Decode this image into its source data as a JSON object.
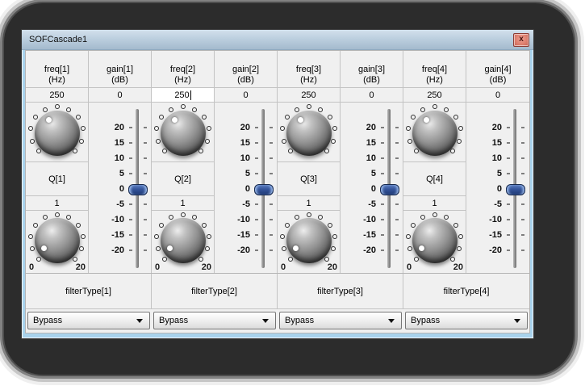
{
  "window": {
    "title": "SOFCascade1",
    "close_glyph": "x"
  },
  "knobs": {
    "freq_indicator_angle_deg": -32,
    "q_indicator_angle_deg": -121
  },
  "gain_scale": {
    "ticks": [
      "20",
      "15",
      "10",
      "5",
      "0",
      "-5",
      "-10",
      "-15",
      "-20"
    ],
    "thumb_value": "0"
  },
  "channels": [
    {
      "freq_label": "freq[1]",
      "freq_unit": "(Hz)",
      "freq_value": "250",
      "freq_editing": false,
      "gain_label": "gain[1]",
      "gain_unit": "(dB)",
      "gain_value": "0",
      "q_label": "Q[1]",
      "q_value": "1",
      "q_min": "0",
      "q_max": "20",
      "filter_label": "filterType[1]",
      "filter_value": "Bypass"
    },
    {
      "freq_label": "freq[2]",
      "freq_unit": "(Hz)",
      "freq_value": "250",
      "freq_editing": true,
      "gain_label": "gain[2]",
      "gain_unit": "(dB)",
      "gain_value": "0",
      "q_label": "Q[2]",
      "q_value": "1",
      "q_min": "0",
      "q_max": "20",
      "filter_label": "filterType[2]",
      "filter_value": "Bypass"
    },
    {
      "freq_label": "freq[3]",
      "freq_unit": "(Hz)",
      "freq_value": "250",
      "freq_editing": false,
      "gain_label": "gain[3]",
      "gain_unit": "(dB)",
      "gain_value": "0",
      "q_label": "Q[3]",
      "q_value": "1",
      "q_min": "0",
      "q_max": "20",
      "filter_label": "filterType[3]",
      "filter_value": "Bypass"
    },
    {
      "freq_label": "freq[4]",
      "freq_unit": "(Hz)",
      "freq_value": "250",
      "freq_editing": false,
      "gain_label": "gain[4]",
      "gain_unit": "(dB)",
      "gain_value": "0",
      "q_label": "Q[4]",
      "q_value": "1",
      "q_min": "0",
      "q_max": "20",
      "filter_label": "filterType[4]",
      "filter_value": "Bypass"
    }
  ],
  "colors": {
    "frame": "#a8d2ec",
    "titlebar_top": "#d2e0ec",
    "titlebar_bottom": "#a4bacd",
    "close_button": "#dd7f6f",
    "slider_thumb": "#34549b",
    "cell_bg": "#f0f0f0"
  }
}
